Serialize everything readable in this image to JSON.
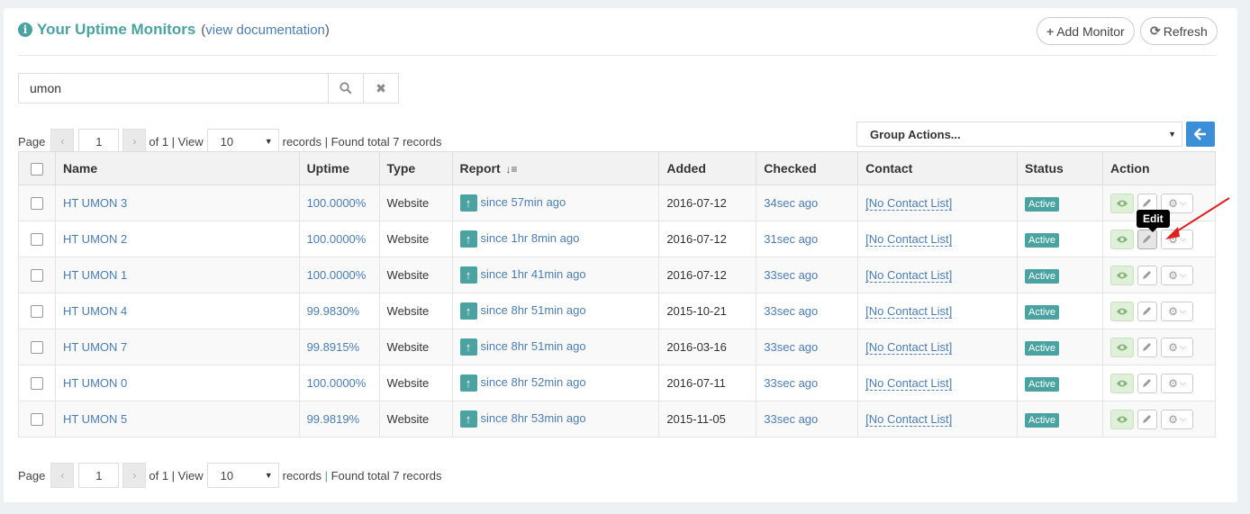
{
  "header": {
    "title": "Your Uptime Monitors",
    "doc_open": "(",
    "doc_link": "view documentation",
    "doc_close": ")",
    "add_label": "Add Monitor",
    "refresh_label": "Refresh"
  },
  "search": {
    "value": "umon"
  },
  "pager": {
    "page_label": "Page",
    "page_value": "1",
    "of_label": "of 1 | View",
    "view_value": "10",
    "records_label": "records",
    "sep": "|",
    "found_label": "Found total 7 records"
  },
  "group_actions": {
    "label": "Group Actions..."
  },
  "table": {
    "headers": [
      "Name",
      "Uptime",
      "Type",
      "Report",
      "Added",
      "Checked",
      "Contact",
      "Status",
      "Action"
    ],
    "rows": [
      {
        "name": "HT UMON 3",
        "uptime": "100.0000%",
        "type": "Website",
        "report": "since 57min ago",
        "added": "2016-07-12",
        "checked": "34sec ago",
        "contact": "[No Contact List]",
        "status": "Active"
      },
      {
        "name": "HT UMON 2",
        "uptime": "100.0000%",
        "type": "Website",
        "report": "since 1hr 8min ago",
        "added": "2016-07-12",
        "checked": "31sec ago",
        "contact": "[No Contact List]",
        "status": "Active"
      },
      {
        "name": "HT UMON 1",
        "uptime": "100.0000%",
        "type": "Website",
        "report": "since 1hr 41min ago",
        "added": "2016-07-12",
        "checked": "33sec ago",
        "contact": "[No Contact List]",
        "status": "Active"
      },
      {
        "name": "HT UMON 4",
        "uptime": "99.9830%",
        "type": "Website",
        "report": "since 8hr 51min ago",
        "added": "2015-10-21",
        "checked": "33sec ago",
        "contact": "[No Contact List]",
        "status": "Active"
      },
      {
        "name": "HT UMON 7",
        "uptime": "99.8915%",
        "type": "Website",
        "report": "since 8hr 51min ago",
        "added": "2016-03-16",
        "checked": "33sec ago",
        "contact": "[No Contact List]",
        "status": "Active"
      },
      {
        "name": "HT UMON 0",
        "uptime": "100.0000%",
        "type": "Website",
        "report": "since 8hr 52min ago",
        "added": "2016-07-11",
        "checked": "33sec ago",
        "contact": "[No Contact List]",
        "status": "Active"
      },
      {
        "name": "HT UMON 5",
        "uptime": "99.9819%",
        "type": "Website",
        "report": "since 8hr 53min ago",
        "added": "2015-11-05",
        "checked": "33sec ago",
        "contact": "[No Contact List]",
        "status": "Active"
      }
    ]
  },
  "tooltip": {
    "text": "Edit"
  },
  "icons": {
    "info": "info-icon",
    "plus": "plus-icon",
    "refresh": "refresh-icon",
    "search": "search-icon",
    "clear": "close-icon",
    "prev": "chevron-left-icon",
    "next": "chevron-right-icon",
    "apply": "arrow-left-icon",
    "up": "arrow-up-icon",
    "view": "eye-icon",
    "edit": "pencil-icon",
    "more": "gear-icon"
  },
  "colors": {
    "accent": "#4aa3a0",
    "link": "#4a7db5",
    "primary": "#3a8fd8",
    "view_green": "#dff0d8",
    "annotation": "#e02020"
  }
}
